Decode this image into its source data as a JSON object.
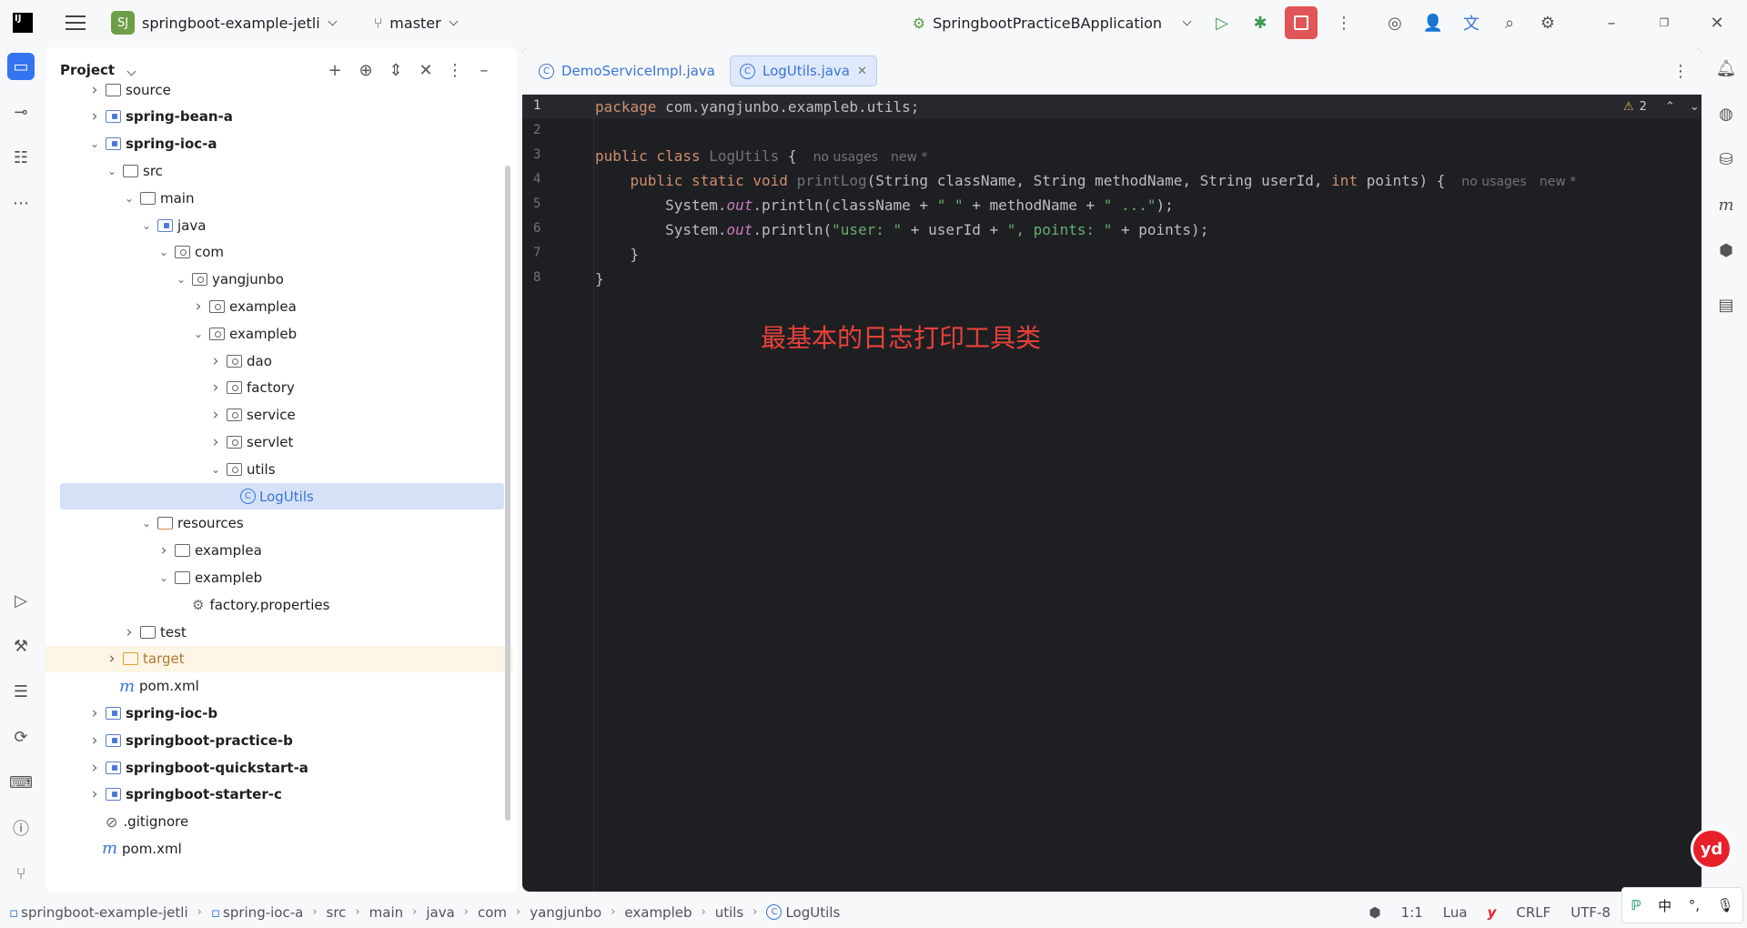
{
  "titlebar": {
    "logo": "IJ",
    "project_badge": "SJ",
    "project_name": "springboot-example-jetli",
    "branch": "master",
    "run_config": "SpringbootPracticeBApplication"
  },
  "project_panel": {
    "title": "Project",
    "tree": [
      {
        "label": "source",
        "depth": 2,
        "kind": "folder",
        "expanded": false
      },
      {
        "label": "spring-bean-a",
        "depth": 2,
        "kind": "module",
        "expanded": false,
        "bold": true
      },
      {
        "label": "spring-ioc-a",
        "depth": 2,
        "kind": "module",
        "expanded": true,
        "bold": true
      },
      {
        "label": "src",
        "depth": 3,
        "kind": "folder",
        "expanded": true
      },
      {
        "label": "main",
        "depth": 4,
        "kind": "folder",
        "expanded": true
      },
      {
        "label": "java",
        "depth": 5,
        "kind": "source",
        "expanded": true
      },
      {
        "label": "com",
        "depth": 6,
        "kind": "package",
        "expanded": true
      },
      {
        "label": "yangjunbo",
        "depth": 7,
        "kind": "package",
        "expanded": true
      },
      {
        "label": "examplea",
        "depth": 8,
        "kind": "package",
        "expanded": false
      },
      {
        "label": "exampleb",
        "depth": 8,
        "kind": "package",
        "expanded": true
      },
      {
        "label": "dao",
        "depth": 9,
        "kind": "package",
        "expanded": false
      },
      {
        "label": "factory",
        "depth": 9,
        "kind": "package",
        "expanded": false
      },
      {
        "label": "service",
        "depth": 9,
        "kind": "package",
        "expanded": false
      },
      {
        "label": "servlet",
        "depth": 9,
        "kind": "package",
        "expanded": false
      },
      {
        "label": "utils",
        "depth": 9,
        "kind": "package",
        "expanded": true
      },
      {
        "label": "LogUtils",
        "depth": 10,
        "kind": "class",
        "selected": true
      },
      {
        "label": "resources",
        "depth": 5,
        "kind": "resources",
        "expanded": true
      },
      {
        "label": "examplea",
        "depth": 6,
        "kind": "folder",
        "expanded": false
      },
      {
        "label": "exampleb",
        "depth": 6,
        "kind": "folder",
        "expanded": true
      },
      {
        "label": "factory.properties",
        "depth": 7,
        "kind": "properties"
      },
      {
        "label": "test",
        "depth": 4,
        "kind": "folder",
        "expanded": false
      },
      {
        "label": "target",
        "depth": 3,
        "kind": "excluded",
        "expanded": false
      },
      {
        "label": "pom.xml",
        "depth": 3,
        "kind": "maven"
      },
      {
        "label": "spring-ioc-b",
        "depth": 2,
        "kind": "module",
        "expanded": false,
        "bold": true
      },
      {
        "label": "springboot-practice-b",
        "depth": 2,
        "kind": "module",
        "expanded": false,
        "bold": true
      },
      {
        "label": "springboot-quickstart-a",
        "depth": 2,
        "kind": "module",
        "expanded": false,
        "bold": true
      },
      {
        "label": "springboot-starter-c",
        "depth": 2,
        "kind": "module",
        "expanded": false,
        "bold": true
      },
      {
        "label": ".gitignore",
        "depth": 2,
        "kind": "ignore"
      },
      {
        "label": "pom.xml",
        "depth": 2,
        "kind": "maven"
      }
    ]
  },
  "editor": {
    "tabs": [
      {
        "label": "DemoServiceImpl.java",
        "active": false
      },
      {
        "label": "LogUtils.java",
        "active": true
      }
    ],
    "warnings": "2",
    "line_numbers": [
      "1",
      "2",
      "3",
      "4",
      "5",
      "6",
      "7",
      "8"
    ],
    "hint_no_usages": "no usages",
    "hint_new": "new *",
    "annotation": "最基本的日志打印工具类"
  },
  "statusbar": {
    "breadcrumbs": [
      "springboot-example-jetli",
      "spring-ioc-a",
      "src",
      "main",
      "java",
      "com",
      "yangjunbo",
      "exampleb",
      "utils",
      "LogUtils"
    ],
    "position": "1:1",
    "language": "Lua",
    "line_ending": "CRLF",
    "encoding": "UTF-8"
  },
  "ime": {
    "lang": "中",
    "punct": "°,"
  },
  "yd_badge": "yd"
}
